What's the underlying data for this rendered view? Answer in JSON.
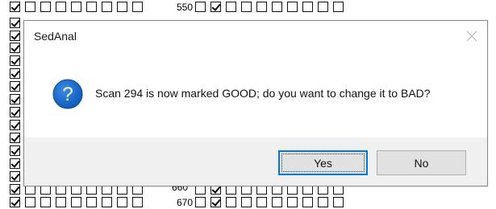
{
  "background": {
    "row_numbers": {
      "top": "550",
      "bottom_1": "660",
      "bottom_2": "670"
    }
  },
  "dialog": {
    "title": "SedAnal",
    "close_icon": "close-icon",
    "icon": "question-icon",
    "message": "Scan 294 is now marked GOOD; do you want to change it to BAD?",
    "buttons": {
      "yes_label": "Yes",
      "no_label": "No"
    },
    "default_button": "Yes"
  },
  "colors": {
    "icon_blue": "#1565c0",
    "focus_blue": "#0078d7",
    "dialog_footer": "#f0f0f0"
  }
}
